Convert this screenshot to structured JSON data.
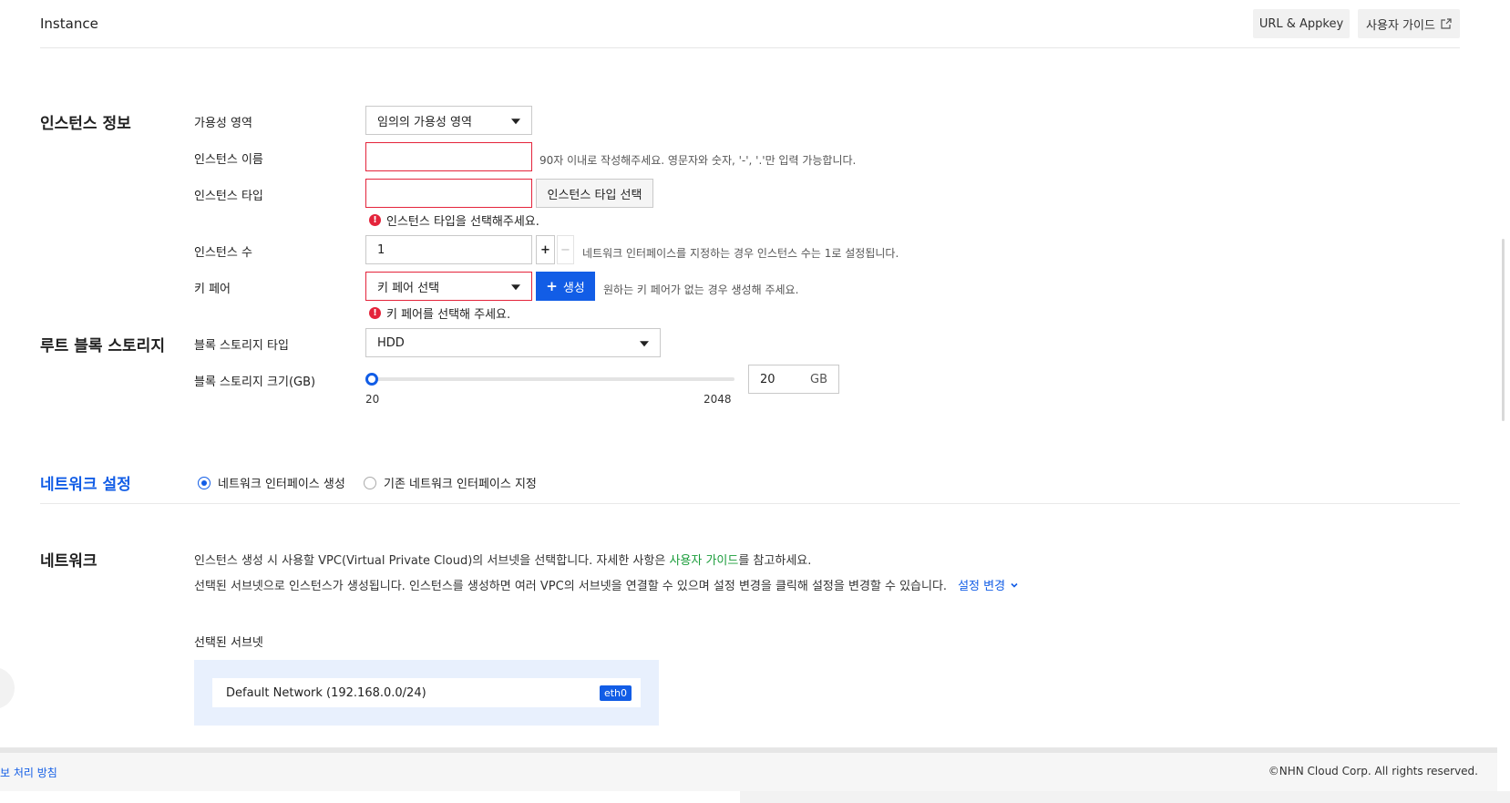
{
  "header": {
    "title": "Instance",
    "url_appkey_label": "URL & Appkey",
    "user_guide_label": "사용자 가이드"
  },
  "instance_info": {
    "section_title": "인스턴스 정보",
    "availability_zone": {
      "label": "가용성 영역",
      "value": "임의의 가용성 영역"
    },
    "instance_name": {
      "label": "인스턴스 이름",
      "value": "",
      "hint": "90자 이내로 작성해주세요. 영문자와 숫자, '-', '.'만 입력 가능합니다."
    },
    "instance_type": {
      "label": "인스턴스 타입",
      "value": "",
      "button": "인스턴스 타입 선택",
      "error": "인스턴스 타입을 선택해주세요."
    },
    "instance_count": {
      "label": "인스턴스 수",
      "value": "1",
      "plus": "+",
      "minus": "−",
      "hint": "네트워크 인터페이스를 지정하는 경우 인스턴스 수는 1로 설정됩니다."
    },
    "key_pair": {
      "label": "키 페어",
      "value": "키 페어 선택",
      "create_button": "생성",
      "hint": "원하는 키 페어가 없는 경우 생성해 주세요.",
      "error": "키 페어를 선택해 주세요."
    }
  },
  "root_storage": {
    "section_title": "루트 블록 스토리지",
    "storage_type": {
      "label": "블록 스토리지 타입",
      "value": "HDD"
    },
    "storage_size": {
      "label": "블록 스토리지 크기(GB)",
      "min": "20",
      "max": "2048",
      "value": "20",
      "unit": "GB",
      "slider_fraction": 0
    }
  },
  "network_settings": {
    "section_title": "네트워크 설정",
    "options": [
      {
        "label": "네트워크 인터페이스 생성",
        "selected": true
      },
      {
        "label": "기존 네트워크 인터페이스 지정",
        "selected": false
      }
    ]
  },
  "network": {
    "section_title": "네트워크",
    "desc1_pre": "인스턴스 생성 시 사용할 VPC(Virtual Private Cloud)의 서브넷을 선택합니다. 자세한 사항은 ",
    "desc1_link": "사용자 가이드",
    "desc1_post": "를 참고하세요.",
    "desc2": "선택된 서브넷으로 인스턴스가 생성됩니다. 인스턴스를 생성하면 여러 VPC의 서브넷을 연결할 수 있으며 설정 변경을 클릭해 설정을 변경할 수 있습니다.",
    "change_link": "설정 변경",
    "selected_subnet_label": "선택된 서브넷",
    "subnet": {
      "name": "Default Network (192.168.0.0/24)",
      "badge": "eth0"
    }
  },
  "footer": {
    "privacy_link": "보 처리 방침",
    "copyright": "©NHN Cloud Corp. All rights reserved."
  },
  "colors": {
    "accent": "#125de6",
    "error": "#e4243b",
    "link_green": "#1a9c3a"
  }
}
